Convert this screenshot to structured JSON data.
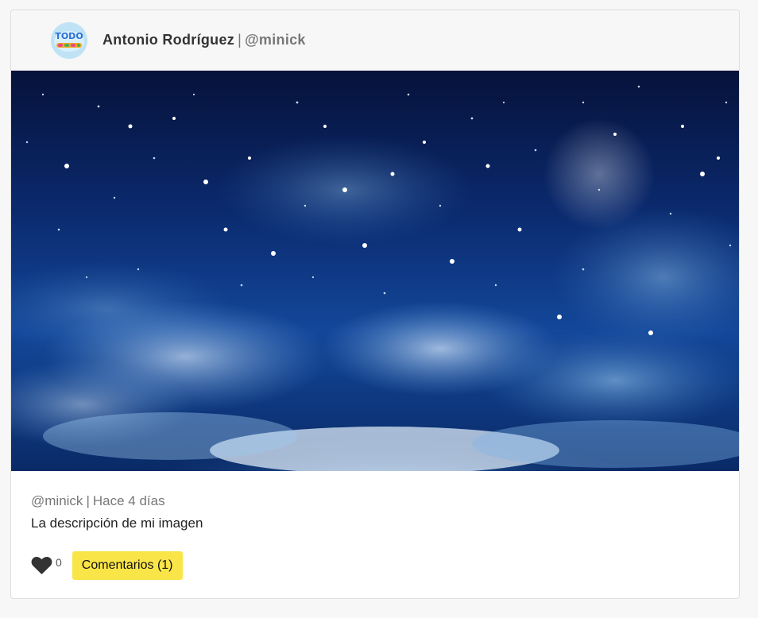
{
  "post": {
    "author_name": "Antonio Rodríguez",
    "separator": "|",
    "author_handle": "@minick",
    "avatar_icon": "todo-logo-icon",
    "meta_handle": "@minick",
    "meta_time": "Hace 4 días",
    "description": "La descripción de mi imagen",
    "like_count": "0",
    "comments_label": "Comentarios (1)"
  },
  "colors": {
    "comments_button_bg": "#f9e547",
    "like_heart": "#333333",
    "header_bg": "#f7f7f7"
  }
}
